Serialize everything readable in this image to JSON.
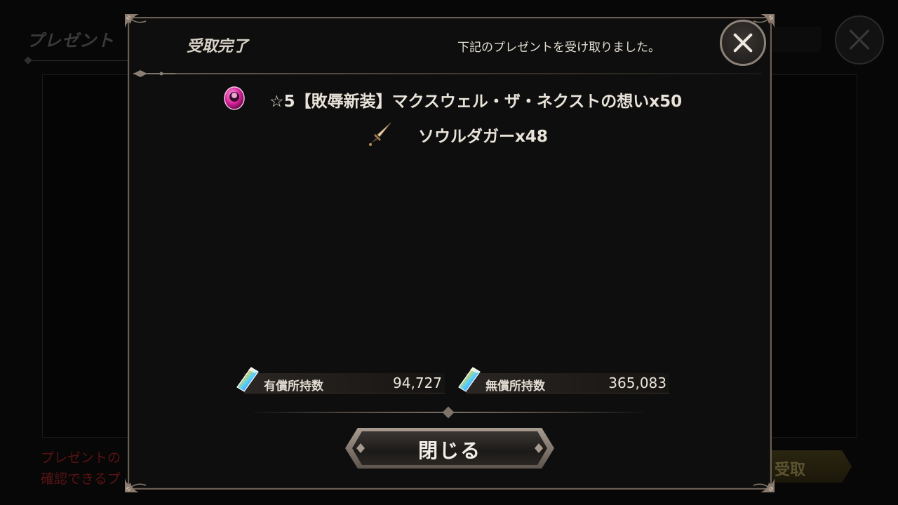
{
  "background": {
    "screen_title": "プレゼント",
    "note_line1": "プレゼントの",
    "note_line2": "確認できるプ",
    "receive_button": "受取"
  },
  "dialog": {
    "title": "受取完了",
    "message": "下記のプレゼントを受け取りました。",
    "items": [
      {
        "icon": "pink-orb-icon",
        "text": "☆5【敗辱新装】マクスウェル・ザ・ネクストの想いx50"
      },
      {
        "icon": "dagger-icon",
        "text": "ソウルダガーx48"
      }
    ],
    "currency": {
      "paid_label": "有償所持数",
      "paid_value": "94,727",
      "free_label": "無償所持数",
      "free_value": "365,083"
    },
    "close_button": "閉じる"
  },
  "colors": {
    "panel_bg": "#0e0e0e",
    "frame": "#6b5f55",
    "text": "#e9e3d9",
    "bg_note_red": "#5a1313"
  }
}
